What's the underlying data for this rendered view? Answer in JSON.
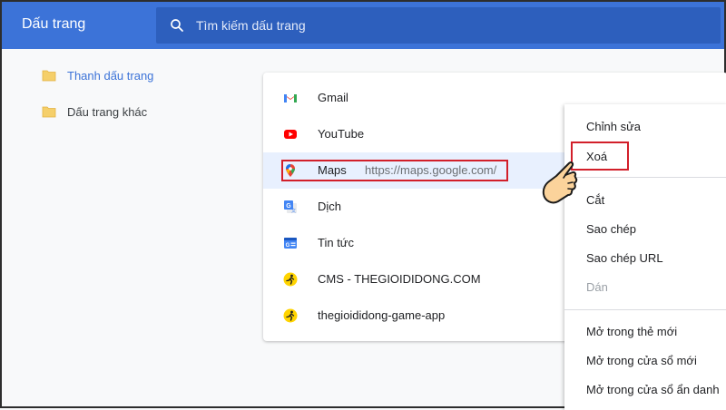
{
  "header": {
    "title": "Dấu trang"
  },
  "search": {
    "placeholder": "Tìm kiếm dấu trang"
  },
  "sidebar": {
    "folders": [
      {
        "label": "Thanh dấu trang",
        "active": true,
        "icon": "folder-icon"
      },
      {
        "label": "Dấu trang khác",
        "active": false,
        "icon": "folder-icon"
      }
    ]
  },
  "bookmarks": [
    {
      "title": "Gmail",
      "icon": "gmail-icon"
    },
    {
      "title": "YouTube",
      "icon": "youtube-icon"
    },
    {
      "title": "Maps",
      "url": "https://maps.google.com/",
      "icon": "maps-icon",
      "selected": true
    },
    {
      "title": "Dịch",
      "icon": "translate-icon"
    },
    {
      "title": "Tin tức",
      "icon": "news-icon"
    },
    {
      "title": "CMS - THEGIOIDIDONG.COM",
      "icon": "tgdd-icon"
    },
    {
      "title": "thegioididong-game-app",
      "icon": "tgdd-icon"
    }
  ],
  "context_menu": {
    "items": [
      {
        "label": "Chỉnh sửa"
      },
      {
        "label": "Xoá",
        "highlighted": true
      },
      {
        "label": "Cắt"
      },
      {
        "label": "Sao chép"
      },
      {
        "label": "Sao chép URL"
      },
      {
        "label": "Dán",
        "disabled": true
      },
      {
        "label": "Mở trong thẻ mới"
      },
      {
        "label": "Mở trong cửa sổ mới"
      },
      {
        "label": "Mở trong cửa sổ ẩn danh"
      }
    ]
  },
  "colors": {
    "header_bg": "#3c73d8",
    "search_bg": "#2d5fbd",
    "active_folder_text": "#3c73d8",
    "selected_row_bg": "#e8f0fe",
    "annotation_red": "#d21f2a"
  }
}
